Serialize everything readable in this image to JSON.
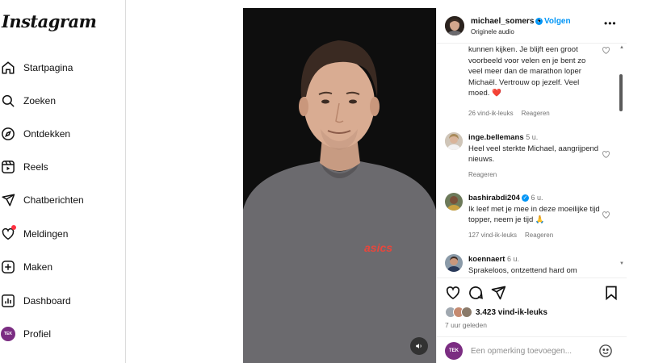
{
  "app": {
    "logo_text": "Instagram"
  },
  "sidebar": {
    "items": [
      {
        "label": "Startpagina",
        "icon": "home-icon"
      },
      {
        "label": "Zoeken",
        "icon": "search-icon"
      },
      {
        "label": "Ontdekken",
        "icon": "compass-icon"
      },
      {
        "label": "Reels",
        "icon": "reels-icon"
      },
      {
        "label": "Chatberichten",
        "icon": "send-icon"
      },
      {
        "label": "Meldingen",
        "icon": "heart-icon"
      },
      {
        "label": "Maken",
        "icon": "plus-square-icon"
      },
      {
        "label": "Dashboard",
        "icon": "chart-icon"
      },
      {
        "label": "Profiel",
        "icon": "profile-avatar"
      }
    ],
    "avatar_text": "TEK"
  },
  "post": {
    "username": "michael_somers",
    "separator": "•",
    "follow_label": "Volgen",
    "audio_label": "Originele audio",
    "more_label": "•••",
    "likes_count": "3.423 vind-ik-leuks",
    "time_ago": "7 uur geleden",
    "comment_placeholder": "Een opmerking toevoegen..."
  },
  "comments": [
    {
      "text": "kunnen kijken. Je blijft een groot voorbeeld voor velen en je bent zo veel meer dan de marathon loper Michaël. Vertrouw op jezelf. Veel moed.",
      "emoji": "❤️",
      "likes": "26 vind-ik-leuks",
      "reply": "Reageren"
    },
    {
      "user": "inge.bellemans",
      "time": "5 u.",
      "text": "Heel veel sterkte Michael, aangrijpend nieuws.",
      "reply": "Reageren"
    },
    {
      "user": "bashirabdi204",
      "time": "6 u.",
      "text": "Ik leef met je mee in deze moeilijke tijd topper, neem je tijd",
      "emoji": "🙏",
      "likes": "127 vind-ik-leuks",
      "reply": "Reageren"
    },
    {
      "user": "koennaert",
      "time": "6 u.",
      "text": "Sprakeloos, ontzettend hard om"
    }
  ],
  "video": {
    "shirt_logo": "asics"
  },
  "colors": {
    "accent": "#0095f6",
    "notification": "#ff3040",
    "heart": "#ed4956",
    "video_bg": "#0e0e0e"
  }
}
